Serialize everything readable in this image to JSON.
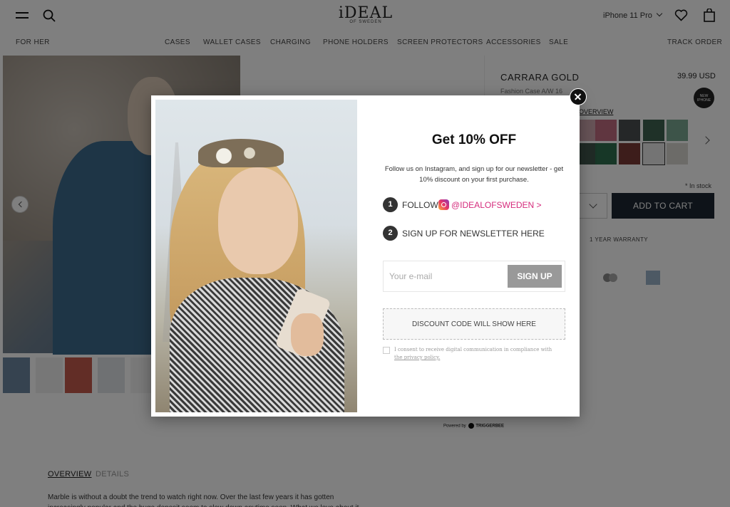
{
  "header": {
    "logo_main": "iDEAL",
    "logo_sub": "OF SWEDEN",
    "device_select": "iPhone 11 Pro",
    "nav": {
      "left": "FOR HER",
      "items": [
        "CASES",
        "WALLET CASES",
        "CHARGING",
        "PHONE HOLDERS",
        "SCREEN PROTECTORS",
        "ACCESSORIES",
        "SALE"
      ],
      "right": "TRACK ORDER"
    }
  },
  "product": {
    "title": "CARRARA GOLD",
    "price": "39.99 USD",
    "subtitle": "Fashion Case  A/W 16",
    "badge": "NEW IPHONE",
    "overview_link": "OVERVIEW",
    "stock": "* In stock",
    "add_to_cart": "ADD TO CART",
    "warranty": "1 YEAR WARRANTY",
    "swatch_colors": [
      "#cfa7ae",
      "#c06c80",
      "#4a4f50",
      "#3e6250",
      "#7aa893",
      "#40574d",
      "#2f6e4e",
      "#7b3a36",
      "#e8e8e8",
      "#d8d6d0"
    ]
  },
  "powered_by": "Powered by",
  "powered_brand": "TRIGGERBEE",
  "tabs": {
    "overview": "OVERVIEW",
    "details": "DETAILS"
  },
  "description": "Marble is without a doubt the trend to watch right now. Over the last few years it has gotten increasingly popular and the huge deposit seem to slow down anytime soon. What we love about it",
  "modal": {
    "title": "Get 10% OFF",
    "description": "Follow us on Instagram, and sign up for our newsletter - get 10% discount on your first purchase.",
    "step1_num": "1",
    "step1_text": "FOLLOW",
    "step1_handle": "@IDEALOFSWEDEN >",
    "step2_num": "2",
    "step2_text": "SIGN UP FOR NEWSLETTER HERE",
    "email_placeholder": "Your e-mail",
    "signup_label": "SIGN UP",
    "discount_text": "DISCOUNT CODE WILL SHOW HERE",
    "consent_text": "I consent to receive digital communication in compliance with ",
    "consent_link": "the privacy policy."
  },
  "colors": {
    "accent_pink": "#d52b7c",
    "cart_button": "#1c2733",
    "signup_button": "#999999"
  }
}
